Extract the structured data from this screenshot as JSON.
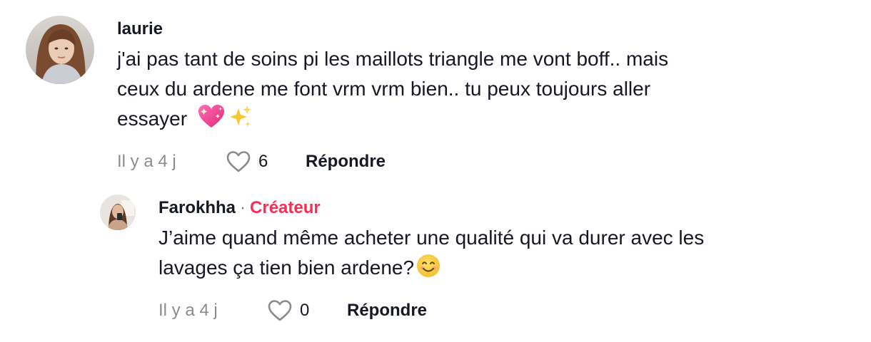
{
  "colors": {
    "creator_accent": "#fe2c55",
    "muted_text": "#8a8b91"
  },
  "comments": [
    {
      "author": "laurie",
      "text_lines": [
        "j'ai pas tant de soins pi les maillots triangle me vont boff.. mais",
        "ceux du ardene me font vrm vrm bien.. tu peux toujours aller",
        "essayer"
      ],
      "emojis": [
        "heart-sparkle-emoji",
        "sparkles-emoji"
      ],
      "time": "Il y a 4 j",
      "like_count": "6",
      "reply_label": "Répondre"
    }
  ],
  "replies": [
    {
      "author": "Farokhha",
      "separator": "·",
      "badge": "Créateur",
      "text_lines": [
        "J’aime quand même acheter une qualité qui va durer avec les",
        "lavages ça tien bien ardene?"
      ],
      "emojis": [
        "smiling-face-emoji"
      ],
      "time": "Il y a 4 j",
      "like_count": "0",
      "reply_label": "Répondre"
    }
  ]
}
